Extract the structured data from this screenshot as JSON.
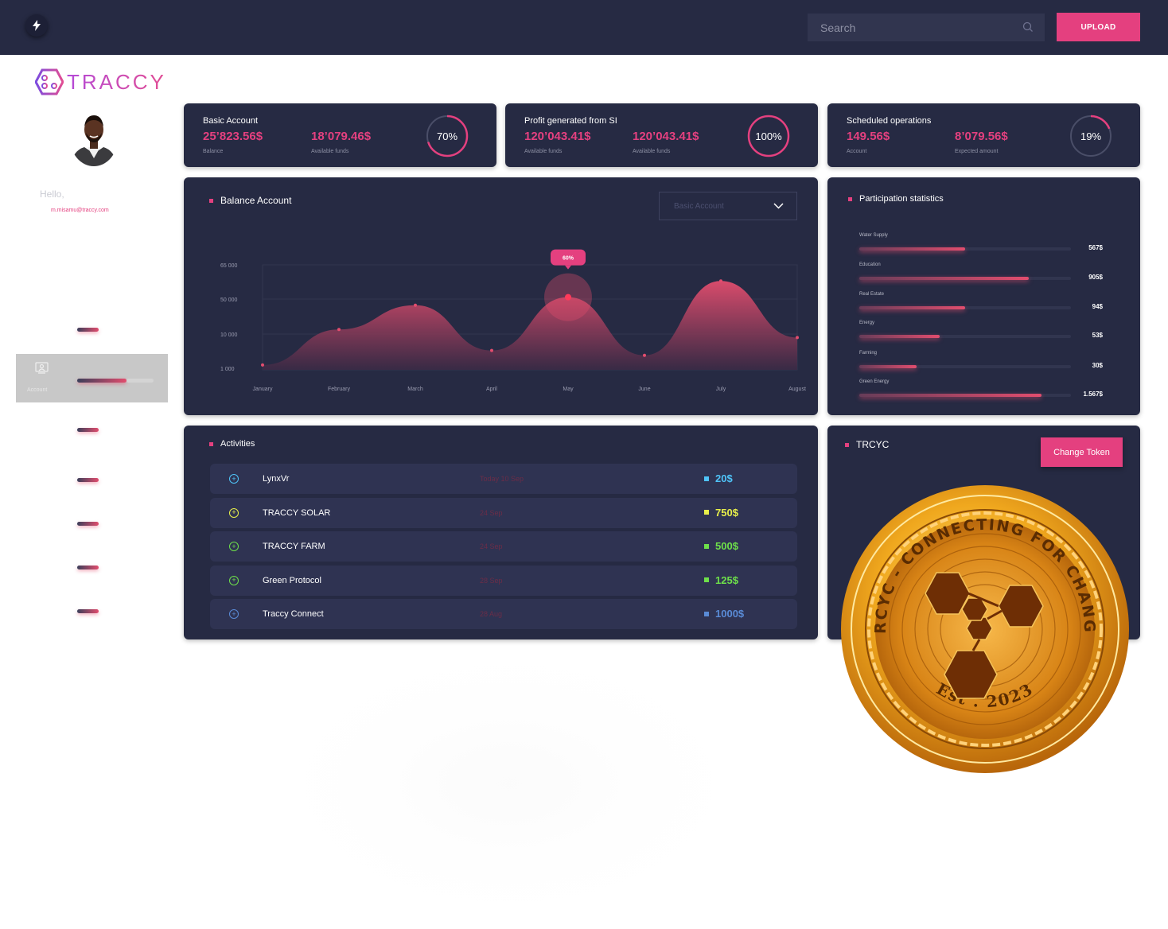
{
  "topbar": {
    "search_placeholder": "Search",
    "upload_label": "UPLOAD"
  },
  "brand": {
    "logo_text": "TRACCY"
  },
  "user": {
    "greeting": "Hello,",
    "email": "m.misamu@traccy.com"
  },
  "sidebar": {
    "active_label": "Account"
  },
  "stats": [
    {
      "title": "Basic Account",
      "value1": "25’823.56$",
      "label1": "Balance",
      "value2": "18’079.46$",
      "label2": "Available funds",
      "percent": "70%",
      "fraction": 0.7
    },
    {
      "title": "Profit generated from SI",
      "value1": "120’043.41$",
      "label1": "Available funds",
      "value2": "120’043.41$",
      "label2": "Available funds",
      "percent": "100%",
      "fraction": 1.0
    },
    {
      "title": "Scheduled operations",
      "value1": "149.56$",
      "label1": "Account",
      "value2": "8’079.56$",
      "label2": "Expected amount",
      "percent": "19%",
      "fraction": 0.19
    }
  ],
  "balance": {
    "title": "Balance Account",
    "select_value": "Basic Account",
    "tooltip": "60%"
  },
  "chart_data": {
    "type": "area",
    "x": [
      "January",
      "February",
      "March",
      "April",
      "May",
      "June",
      "July",
      "August"
    ],
    "y_ticks": [
      "65 000",
      "50 000",
      "10 000",
      "1 000"
    ],
    "series": [
      {
        "values": [
          3000,
          25000,
          40000,
          12000,
          45000,
          9000,
          55000,
          20000
        ]
      }
    ],
    "highlight": {
      "category": "May",
      "label": "60%"
    },
    "colors": {
      "fill_top": "#e24d6e",
      "fill_bottom": "#3a2a45"
    }
  },
  "participation": {
    "title": "Participation statistics",
    "items": [
      {
        "label": "Water Supply",
        "value": "567$",
        "fraction": 0.5
      },
      {
        "label": "Education",
        "value": "905$",
        "fraction": 0.8
      },
      {
        "label": "Real Estate",
        "value": "94$",
        "fraction": 0.5
      },
      {
        "label": "Energy",
        "value": "53$",
        "fraction": 0.38
      },
      {
        "label": "Farming",
        "value": "30$",
        "fraction": 0.27
      },
      {
        "label": "Green Energy",
        "value": "1.567$",
        "fraction": 0.86
      }
    ]
  },
  "activities": {
    "title": "Activities",
    "rows": [
      {
        "name": "LynxVr",
        "date": "Today 10 Sep",
        "amount": "20$",
        "color": "#4fc3f7"
      },
      {
        "name": "TRACCY SOLAR",
        "date": "24 Sep",
        "amount": "750$",
        "color": "#e8f04a"
      },
      {
        "name": "TRACCY FARM",
        "date": "24 Sep",
        "amount": "500$",
        "color": "#6ee04a"
      },
      {
        "name": "Green Protocol",
        "date": "28 Sep",
        "amount": "125$",
        "color": "#6ee04a"
      },
      {
        "name": "Traccy Connect",
        "date": "28 Aug",
        "amount": "1000$",
        "color": "#5a8bd6"
      }
    ]
  },
  "token": {
    "title": "TRCYC",
    "button_label": "Change Token",
    "coin_top_text": "TRCYC - CONNECTING FOR CHANGE",
    "coin_bottom_text": "Est . 2023"
  }
}
